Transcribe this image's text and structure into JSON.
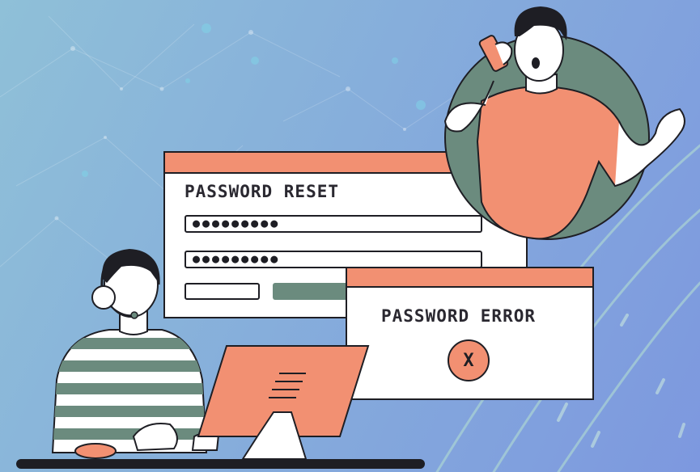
{
  "reset_window": {
    "title": "PASSWORD RESET",
    "password_field_1": "●●●●●●●●●",
    "password_field_2": "●●●●●●●●●"
  },
  "error_window": {
    "title": "PASSWORD ERROR",
    "icon_symbol": "X"
  },
  "colors": {
    "accent": "#f29072",
    "dark_green": "#6b8b7e",
    "outline": "#1e1e24",
    "background": "#86aedb"
  }
}
